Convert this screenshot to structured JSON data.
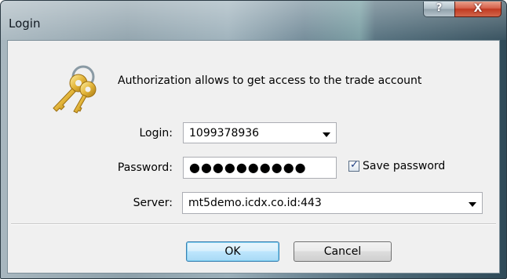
{
  "window": {
    "title": "Login",
    "help_glyph": "?",
    "close_glyph": "X"
  },
  "dialog": {
    "banner": "Authorization allows to get access to the trade account",
    "icon": "keys-icon"
  },
  "form": {
    "login_label": "Login:",
    "login_value": "1099378936",
    "password_label": "Password:",
    "password_value": "●●●●●●●●●●",
    "save_password_label": "Save password",
    "save_password_checked": true,
    "server_label": "Server:",
    "server_value": "mt5demo.icdx.co.id:443"
  },
  "buttons": {
    "ok_label": "OK",
    "cancel_label": "Cancel"
  },
  "colors": {
    "close_button": "#c13a22",
    "default_button_border": "#3c7fb1"
  }
}
